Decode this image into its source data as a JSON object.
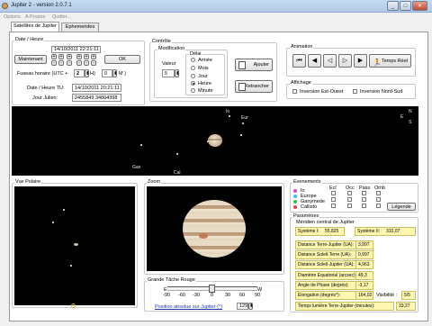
{
  "window": {
    "title": "Jupiter 2 - version 2.0.7.1",
    "min": "_",
    "max": "□",
    "close": "✕"
  },
  "menu": [
    "Options",
    "A Propos",
    "Quitter..."
  ],
  "tabs": [
    "Satellites de Jupiter",
    "Ephemerides"
  ],
  "date_heure": {
    "group_label": "Date / Heure",
    "date_value": "14/10/2011 22:21:11",
    "maintenant": "Maintenant",
    "plus": "+",
    "minus": "-",
    "ok": "OK",
    "fuseau_label": "Fuseau horaire (UTC +",
    "fuseau_value": "2",
    "h_label": "H)",
    "m_value": "0",
    "m_label": "M )",
    "tu_label": "Date / Heure TU:",
    "tu_value": "14/10/2011 20:21:11",
    "jj_label": "Jour Julien:",
    "jj_value": "2455849.34804398"
  },
  "controle": {
    "group_label": "Contrôle",
    "modification_label": "Modification",
    "valeur_label": "Valeur",
    "valeur_value": "5",
    "delai_label": "Délai",
    "delai_options": [
      "Année",
      "Mois",
      "Jour",
      "Heure",
      "Minute"
    ],
    "delai_selected_index": 3,
    "ajouter": "Ajouter",
    "retrancher": "Retrancher"
  },
  "animation": {
    "group_label": "Animation",
    "temps_reel": "Temps Réel"
  },
  "affichage": {
    "group_label": "Affichage",
    "inversion_eo": "Inversion Est-Ouest",
    "inversion_ns": "Inversion Nord-Sud"
  },
  "sky": {
    "moons": [
      "Io",
      "Eur",
      "Gan",
      "Cal"
    ],
    "compass_e": "E",
    "compass_n": "N",
    "compass_s": "S"
  },
  "vue_polaire": {
    "group_label": "Vue Polaire"
  },
  "zoom": {
    "group_label": "Zoom"
  },
  "tache_rouge": {
    "group_label": "Grande Tâche Rouge",
    "scale_labels": [
      "-90",
      "-60",
      "-30",
      "0",
      "30",
      "60",
      "90"
    ],
    "scale_e": "E",
    "scale_w": "W",
    "position_label": "Position absolue sur Jupiter (°)",
    "position_value": "129"
  },
  "evenements": {
    "group_label": "Evenements",
    "columns": [
      "Ecl",
      "Occ",
      "Pass",
      "Omb"
    ],
    "moons": [
      {
        "name": "Io",
        "color": "#e040e0"
      },
      {
        "name": "Europe",
        "color": "#40c0e0"
      },
      {
        "name": "Ganymede",
        "color": "#40c040"
      },
      {
        "name": "Callisto",
        "color": "#e04040"
      }
    ],
    "legende": "Légende"
  },
  "parametres": {
    "group_label": "Paramètres",
    "meridien_label": "Méridien central de Jupiter",
    "systeme1_label": "Système I:",
    "systeme1_value": "55,825",
    "systeme2_label": "Système II:",
    "systeme2_value": "310,07",
    "rows": [
      {
        "label": "Distance Terre-Jupiter (UA):",
        "value": "3,997"
      },
      {
        "label": "Distance Soleil-Terre (UA):",
        "value": "0,997"
      },
      {
        "label": "Distance Soleil-Jupiter (UA):",
        "value": "4,963"
      },
      {
        "label": "Diamètre Equatorial (arcsec):",
        "value": "49,3"
      },
      {
        "label": "Angle de Phase (degrés):",
        "value": "-3,17"
      }
    ],
    "elongation_label": "Elongation (degrés°):",
    "elongation_value": "164,02",
    "visibilite_label": "Visibilité :",
    "visibilite_value": "5/5",
    "temps_lumiere_label": "Temps lumière Terre-Jupiter (minutes):",
    "temps_lumiere_value": "33,27"
  }
}
